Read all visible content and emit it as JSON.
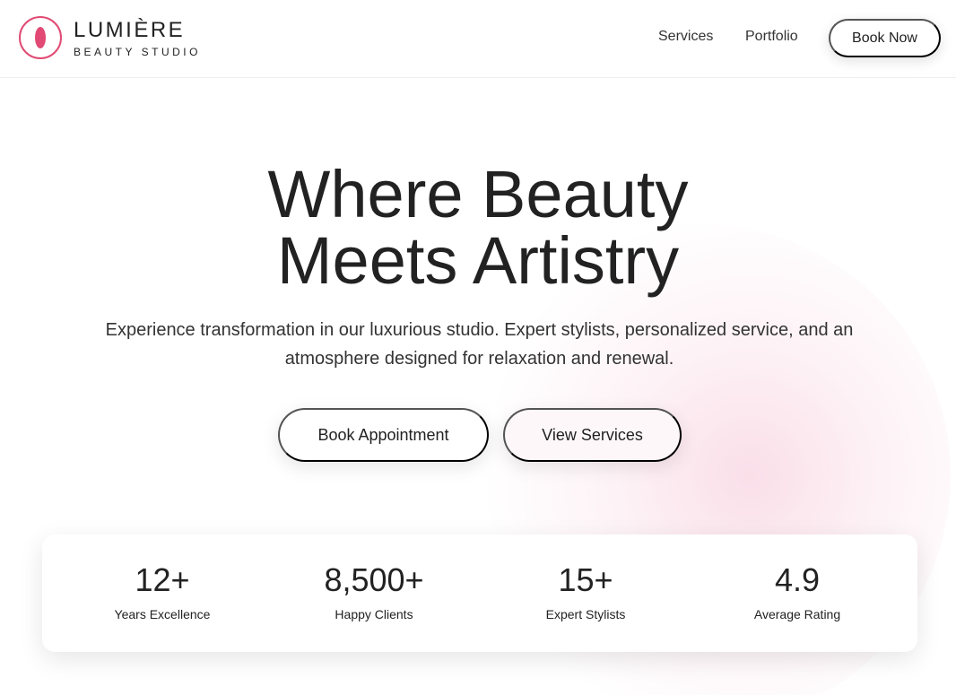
{
  "brand": {
    "name": "LUMIÈRE",
    "subtitle": "BEAUTY STUDIO",
    "logo_icon": "leaf-icon",
    "accent_color": "#e14a74"
  },
  "nav": {
    "links": [
      "Services",
      "Portfolio"
    ],
    "cta": "Book Now"
  },
  "hero": {
    "title_lines": [
      "Where Beauty",
      "Meets Artistry"
    ],
    "text": "Experience transformation in our luxurious studio. Expert stylists, personalized service, and an atmosphere designed for relaxation and renewal.",
    "buttons": [
      "Book Appointment",
      "View Services"
    ]
  },
  "stats": [
    {
      "value": "12+",
      "label": "Years Excellence"
    },
    {
      "value": "8,500+",
      "label": "Happy Clients"
    },
    {
      "value": "15+",
      "label": "Expert Stylists"
    },
    {
      "value": "4.9",
      "label": "Average Rating"
    }
  ]
}
